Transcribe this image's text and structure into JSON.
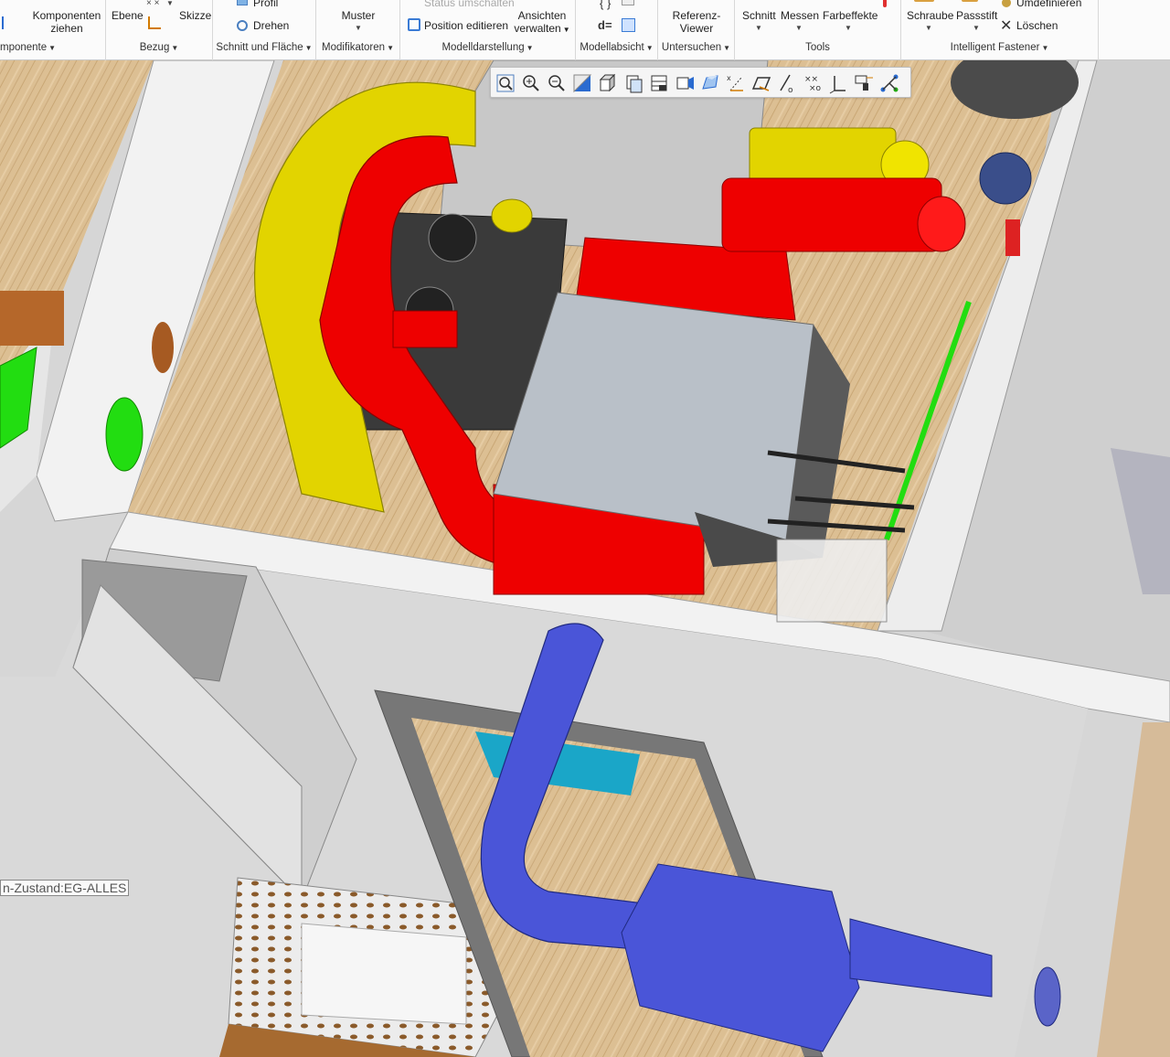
{
  "ribbon": {
    "groups": [
      {
        "id": "komponente",
        "title": "mponente"
      },
      {
        "id": "bezug",
        "title": "Bezug"
      },
      {
        "id": "schnitt",
        "title": "Schnitt und Fläche"
      },
      {
        "id": "modifikatoren",
        "title": "Modifikatoren"
      },
      {
        "id": "modelldarstellung",
        "title": "Modelldarstellung"
      },
      {
        "id": "modellabsicht",
        "title": "Modellabsicht"
      },
      {
        "id": "untersuchen",
        "title": "Untersuchen"
      },
      {
        "id": "tools",
        "title": "Tools"
      },
      {
        "id": "fastener",
        "title": "Intelligent Fastener"
      }
    ],
    "buttons": {
      "komponenten_ziehen_1": "Komponenten",
      "komponenten_ziehen_2": "ziehen",
      "ebene": "Ebene",
      "skizze": "Skizze",
      "profil": "Profil",
      "drehen": "Drehen",
      "muster": "Muster",
      "status_umschalten": "Status umschalten",
      "position_editieren": "Position editieren",
      "ansichten_1": "Ansichten",
      "ansichten_2": "verwalten",
      "referenz_1": "Referenz-",
      "referenz_2": "Viewer",
      "schnitt": "Schnitt",
      "messen": "Messen",
      "farbeffekte": "Farbeffekte",
      "schraube": "Schraube",
      "passstift": "Passstift",
      "umdefinieren": "Umdefinieren",
      "loeschen": "Löschen"
    }
  },
  "graphics_toolbar": {
    "tools": [
      "zoom-fit-icon",
      "zoom-in-icon",
      "zoom-out-icon",
      "repaint-icon",
      "orientation-icon",
      "saved-views-icon",
      "display-style-icon",
      "perspective-icon",
      "annotation-display-icon",
      "csys-display-icon",
      "plane-display-icon",
      "axis-display-icon",
      "point-display-icon",
      "csys-tag-icon",
      "spin-center-icon",
      "flow-icon"
    ]
  },
  "viewport": {
    "state_label": "n-Zustand:EG-ALLES",
    "colors": {
      "yellow_duct": "#e2d400",
      "red_duct": "#ee0000",
      "green_duct": "#22dd11",
      "brown_duct": "#b5672a",
      "blue_duct": "#4a55d8",
      "floor_wood": "#d9b98a",
      "wall": "#f2f2f2",
      "unit_gray": "#b9c0c8"
    }
  }
}
